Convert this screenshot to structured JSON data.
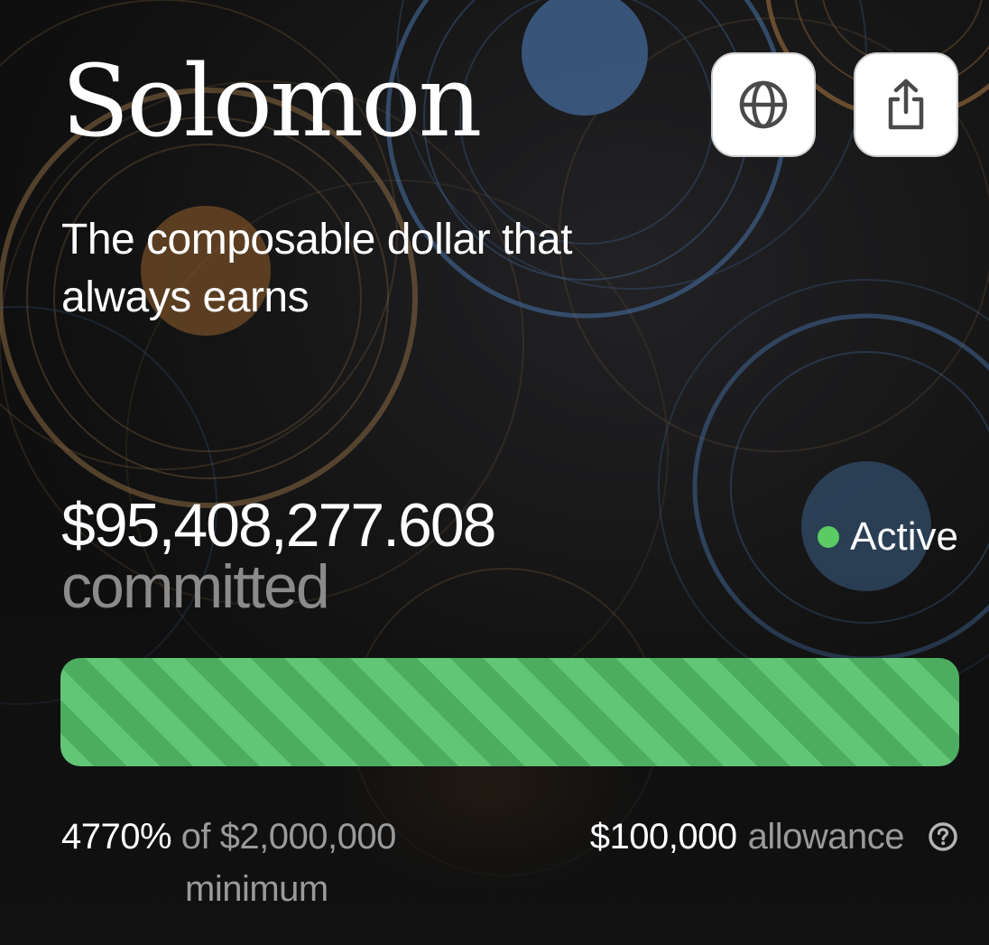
{
  "project": {
    "name": "Solomon",
    "tagline": "The composable dollar that always earns"
  },
  "actions": {
    "website_icon": "globe-icon",
    "share_icon": "share-icon"
  },
  "commitment": {
    "amount": "$95,408,277.608",
    "label": "committed",
    "status": "Active",
    "status_color": "#5bcc64",
    "progress_fraction": 1.0,
    "progress_color": "#57b96b"
  },
  "footer": {
    "percent": "4770%",
    "of_label": "of",
    "minimum_amount": "$2,000,000",
    "minimum_label": "minimum",
    "allowance_amount": "$100,000",
    "allowance_label": "allowance",
    "help_icon": "question-circle-icon"
  }
}
